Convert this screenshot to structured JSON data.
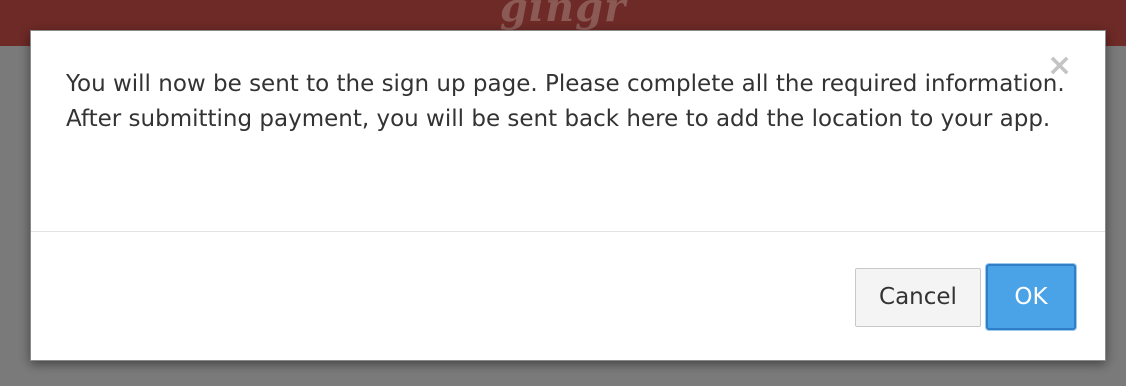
{
  "app": {
    "logo_text": "gingr"
  },
  "dialog": {
    "message": "You will now be sent to the sign up page. Please complete all the required information. After submitting payment, you will be sent back here to add the location to your app.",
    "close_symbol": "×",
    "cancel_label": "Cancel",
    "ok_label": "OK"
  },
  "colors": {
    "header_bg": "#6e2a27",
    "backdrop": "#7a7a7a",
    "primary_button": "#4aa3e6",
    "text": "#333333"
  },
  "icons": {
    "close": "close-icon"
  }
}
